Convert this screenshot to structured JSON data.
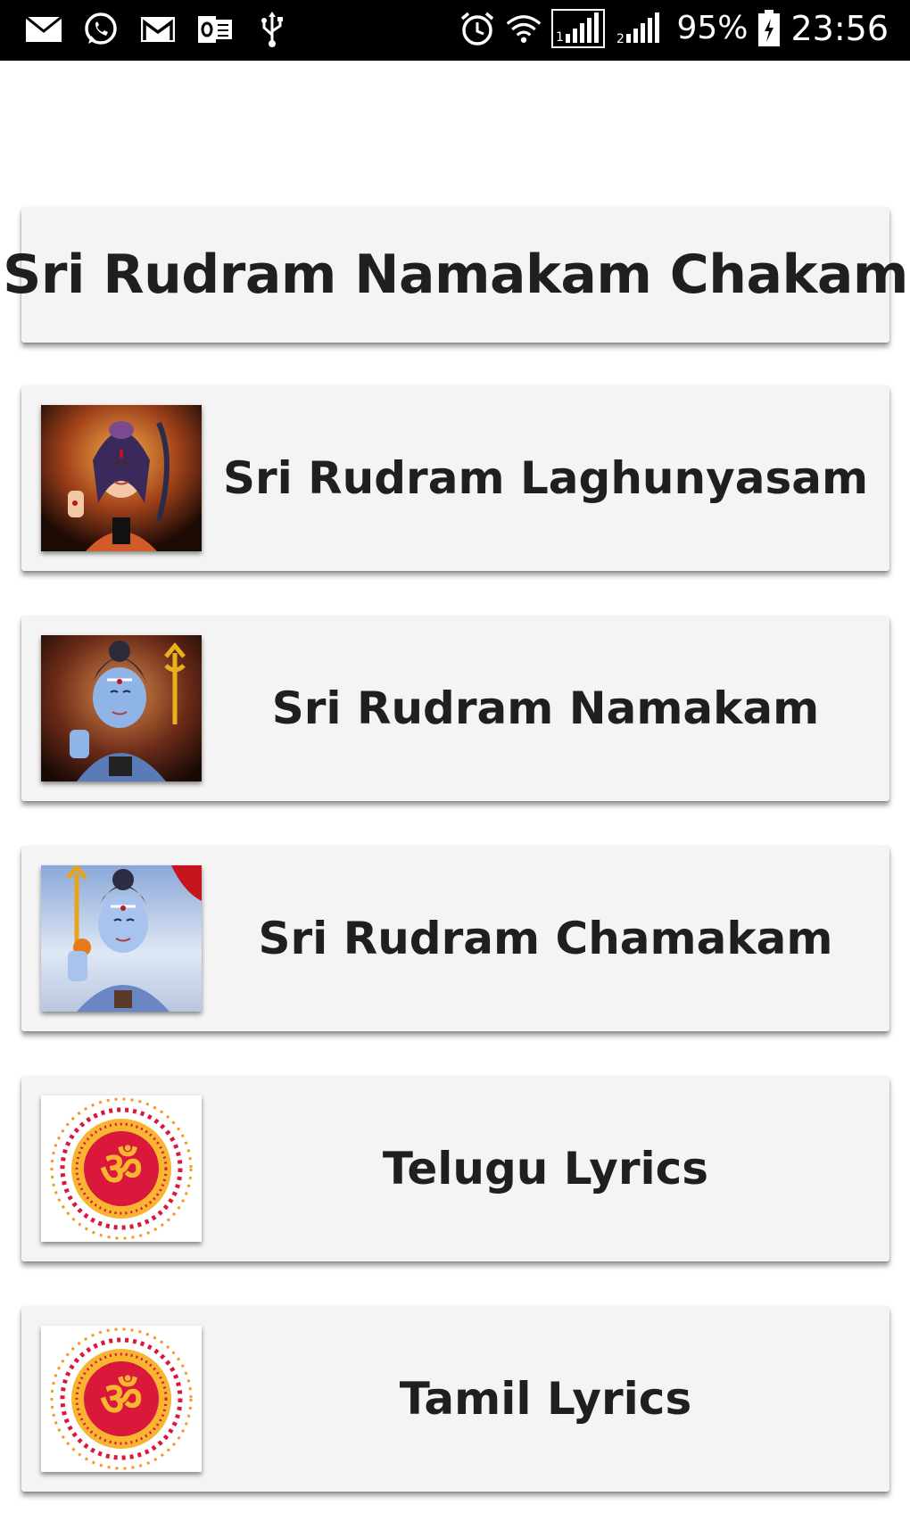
{
  "status_bar": {
    "battery": "95%",
    "time": "23:56",
    "left_icons": [
      "mail-icon",
      "whatsapp-icon",
      "gmail-icon",
      "outlook-icon",
      "usb-icon"
    ],
    "right_icons": [
      "alarm-icon",
      "wifi-icon",
      "signal-sim1-icon",
      "signal-sim2-icon",
      "battery-charging-icon"
    ]
  },
  "header": {
    "title": "Sri Rudram Namakam Chakam"
  },
  "items": [
    {
      "label": "Sri Rudram Laghunyasam",
      "icon": "shiva-image-1"
    },
    {
      "label": "Sri Rudram Namakam",
      "icon": "shiva-image-2"
    },
    {
      "label": "Sri Rudram Chamakam",
      "icon": "shiva-image-3"
    },
    {
      "label": "Telugu Lyrics",
      "icon": "om-mandala-icon"
    },
    {
      "label": "Tamil Lyrics",
      "icon": "om-mandala-icon"
    }
  ],
  "colors": {
    "card_background": "#f4f4f4",
    "text": "#1f1f1f",
    "status_bar": "#000000",
    "om_red": "#d9183b",
    "om_orange": "#f39a1e"
  }
}
